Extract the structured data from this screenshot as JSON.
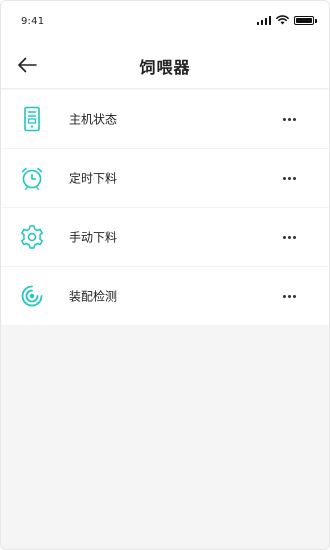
{
  "status_bar": {
    "time": "9:41"
  },
  "nav": {
    "title": "饲喂器"
  },
  "theme": {
    "accent": "#1fc6c0",
    "background": "#f5f5f5"
  },
  "menu": {
    "items": [
      {
        "label": "主机状态",
        "icon": "device-host-icon"
      },
      {
        "label": "定时下料",
        "icon": "alarm-clock-icon"
      },
      {
        "label": "手动下料",
        "icon": "gear-icon"
      },
      {
        "label": "装配检测",
        "icon": "detection-signal-icon"
      }
    ]
  }
}
